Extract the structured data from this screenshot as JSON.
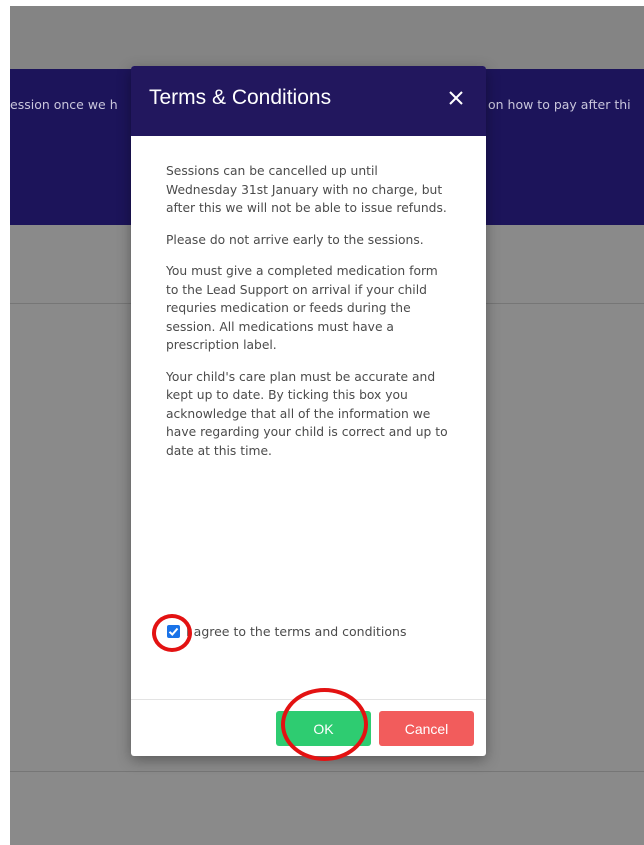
{
  "background": {
    "banner_left_text": "ession once we h",
    "banner_right_text": "on how to pay after thi"
  },
  "modal": {
    "title": "Terms & Conditions",
    "close_icon": "close-icon",
    "paragraphs": [
      "Sessions can be cancelled up until Wednesday 31st January with no charge, but after this we will not be able to issue refunds.",
      "Please do not arrive early to the sessions.",
      "You must give a completed medication form to the Lead Support on arrival if your child requries medication or feeds during the session. All medications must have a prescription label.",
      "Your child's care plan must be accurate and kept up to date. By ticking this box you acknowledge that all of the information we have regarding your child is correct and up to date at this time."
    ],
    "agree_label": "I agree to the terms and conditions",
    "agree_checked": true,
    "ok_label": "OK",
    "cancel_label": "Cancel"
  },
  "colors": {
    "banner": "#1c145a",
    "header": "#22175e",
    "ok": "#2ecc71",
    "cancel": "#f25c5c",
    "annotation": "#e31212"
  }
}
